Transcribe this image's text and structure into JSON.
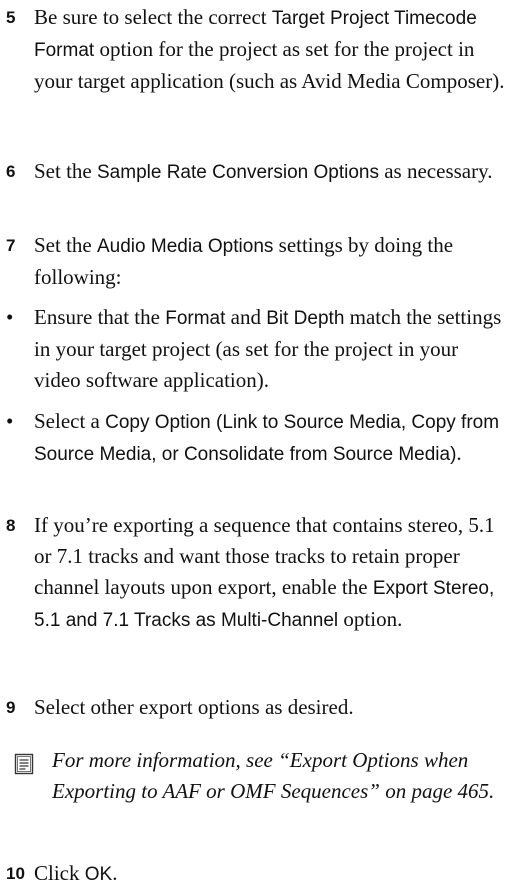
{
  "steps": [
    {
      "num": "5",
      "pre": "Be sure to select the correct ",
      "ui": "Target Project Timecode Format",
      "post": " option for the project as set for the project in your target application (such as Avid Media Composer)."
    },
    {
      "num": "6",
      "pre": "Set the ",
      "ui": "Sample Rate Conversion Options",
      "post": " as necessary."
    },
    {
      "num": "7",
      "pre": "Set the ",
      "ui": "Audio Media Options",
      "post": " settings by doing the following:"
    },
    {
      "num": "8",
      "pre": "If you’re exporting a sequence that contains stereo, 5.1 or 7.1 tracks and want those tracks to retain proper channel layouts upon export, enable the ",
      "ui": "Export Stereo, 5.1 and 7.1 Tracks as Multi-Channel",
      "post": " option."
    },
    {
      "num": "9",
      "pre": "Select other export options as desired."
    },
    {
      "num": "10",
      "pre": "Click ",
      "ui": "OK",
      "post": "."
    }
  ],
  "bullets": [
    {
      "pre": "Ensure that the ",
      "ui1": "Format",
      "mid": " and ",
      "ui2": "Bit Depth",
      "post": " match the settings in your target project (as set for the project in your video software application)."
    },
    {
      "pre": "Select a ",
      "ui": "Copy Option (Link to Source Media, Copy from Source Media, or Consolidate from Source Media)",
      "post": "."
    }
  ],
  "bullet_char": "•",
  "note": {
    "icon": "note-icon",
    "text": "For more information, see “Export Options when Exporting to AAF or OMF Sequences” on page 465."
  }
}
